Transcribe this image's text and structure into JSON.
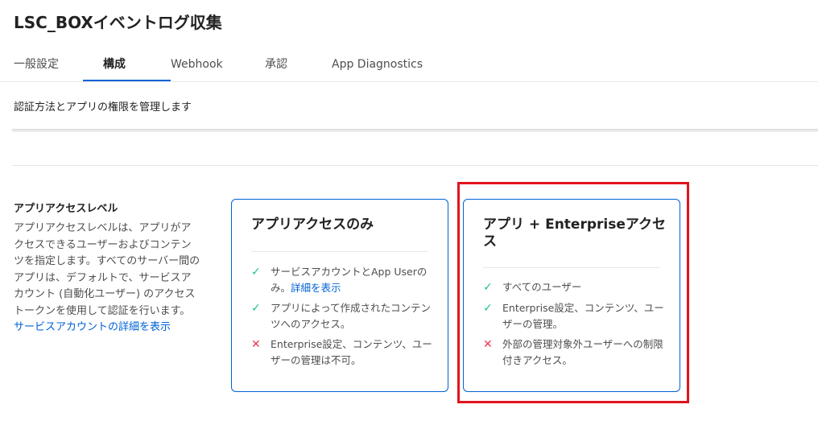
{
  "app": {
    "title": "LSC_BOXイベントログ収集"
  },
  "tabs": [
    {
      "label": "一般設定"
    },
    {
      "label": "構成"
    },
    {
      "label": "Webhook"
    },
    {
      "label": "承認"
    },
    {
      "label": "App Diagnostics"
    }
  ],
  "page": {
    "description": "認証方法とアプリの権限を管理します"
  },
  "access_section": {
    "title": "アプリアクセスレベル",
    "description": "アプリアクセスレベルは、アプリがアクセスできるユーザーおよびコンテンツを指定します。すべてのサーバー間のアプリは、デフォルトで、サービスアカウント (自動化ユーザー) のアクセストークンを使用して認証を行います。",
    "link": "サービスアカウントの詳細を表示"
  },
  "cards": [
    {
      "title": "アプリアクセスのみ",
      "features": [
        {
          "icon": "check-icon",
          "text": "サービスアカウントとApp Userのみ。",
          "link": "詳細を表示"
        },
        {
          "icon": "check-icon",
          "text": "アプリによって作成されたコンテンツへのアクセス。"
        },
        {
          "icon": "cross-icon",
          "text": "Enterprise設定、コンテンツ、ユーザーの管理は不可。"
        }
      ]
    },
    {
      "title": "アプリ + Enterpriseアクセス",
      "features": [
        {
          "icon": "check-icon",
          "text": "すべてのユーザー"
        },
        {
          "icon": "check-icon",
          "text": "Enterprise設定、コンテンツ、ユーザーの管理。"
        },
        {
          "icon": "cross-icon",
          "text": "外部の管理対象外ユーザーへの制限付きアクセス。"
        }
      ]
    }
  ],
  "colors": {
    "accent": "#0061d5",
    "check": "#26c281",
    "cross": "#ed3757",
    "highlight": "#e0141e"
  }
}
